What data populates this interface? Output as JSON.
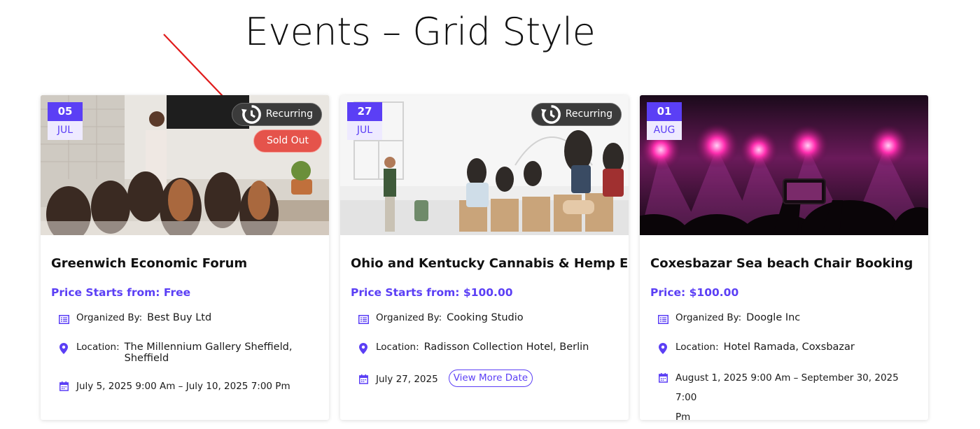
{
  "page": {
    "title": "Events – Grid Style"
  },
  "colors": {
    "accent": "#5b3ff5",
    "sold_out": "#e5534b",
    "recurring_bg": "#3b3b3b",
    "arrow": "#e01b1b"
  },
  "labels": {
    "organized_by": "Organized By:",
    "location": "Location:",
    "recurring": "Recurring",
    "sold_out": "Sold Out",
    "view_more_date": "View More Date"
  },
  "events": [
    {
      "day": "05",
      "month": "JUL",
      "title": "Greenwich Economic Forum",
      "price_label": "Price Starts from:",
      "price": "Free",
      "organizer": "Best Buy Ltd",
      "location": "The Millennium Gallery Sheffield, Sheffield",
      "date_line1": "July 5, 2025  9:00 Am – July 10, 2025 7:00 Pm",
      "recurring": true,
      "sold_out": true,
      "image": "conference-presentation"
    },
    {
      "day": "27",
      "month": "JUL",
      "title": "Ohio and Kentucky Cannabis & Hemp Expo",
      "price_label": "Price Starts from:",
      "price": "$100.00",
      "organizer": "Cooking Studio",
      "location": "Radisson Collection Hotel, Berlin",
      "date_line1": "July 27, 2025",
      "recurring": true,
      "sold_out": false,
      "image": "audience-applauding"
    },
    {
      "day": "01",
      "month": "AUG",
      "title": "Coxesbazar Sea beach Chair Booking",
      "price_label": "Price:",
      "price": "$100.00",
      "organizer": "Doogle Inc",
      "location": "Hotel Ramada, Coxsbazar",
      "date_line1": "August 1, 2025  9:00 Am – September 30, 2025 7:00",
      "date_line2": "Pm",
      "recurring": false,
      "sold_out": false,
      "image": "concert-lights"
    }
  ]
}
